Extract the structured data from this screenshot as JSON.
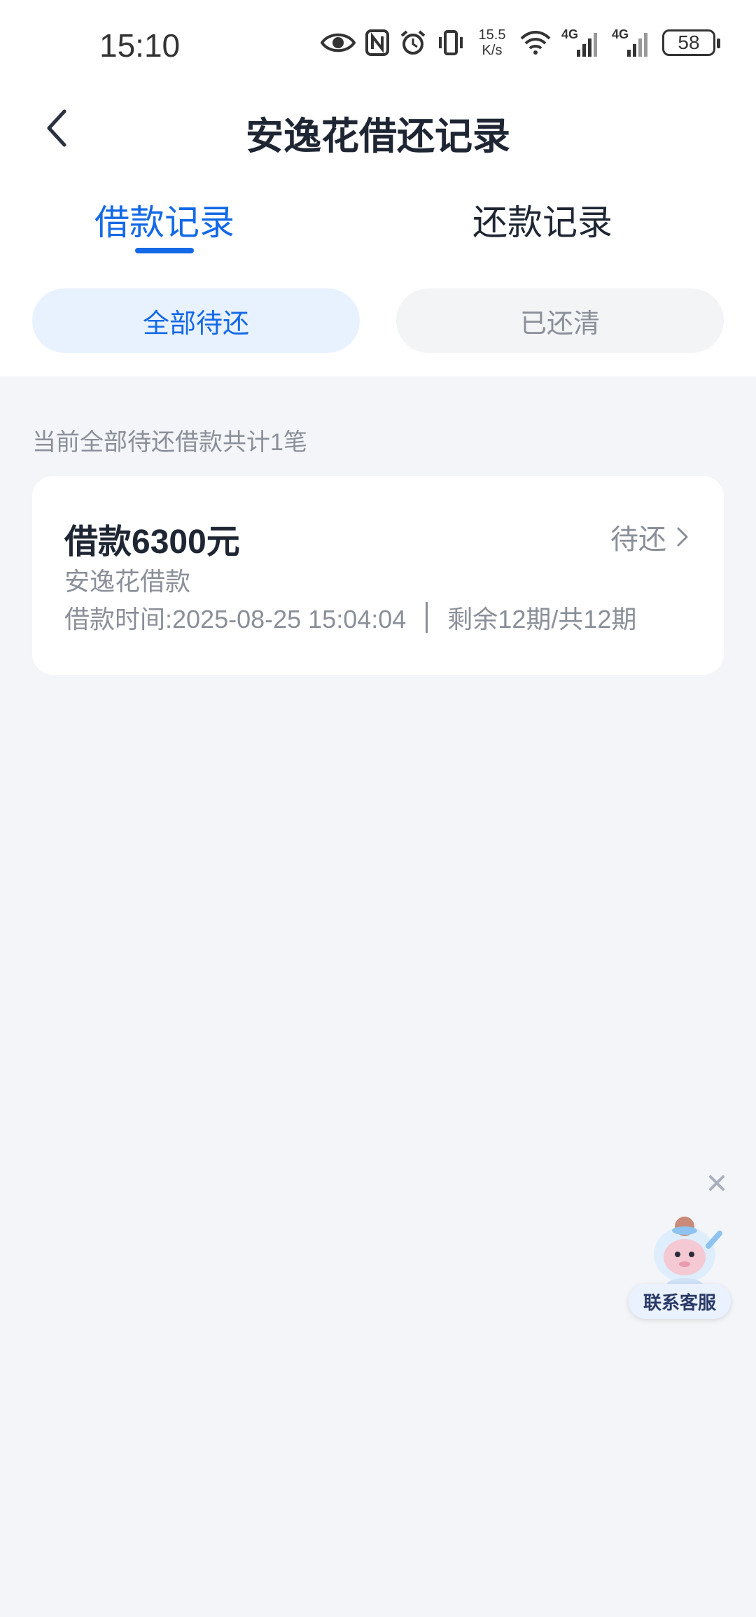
{
  "status_bar": {
    "time": "15:10",
    "net_speed_value": "15.5",
    "net_speed_unit": "K/s",
    "signal1_label": "4G",
    "signal2_label": "4G",
    "battery": "58",
    "icons": [
      "eye-icon",
      "nfc-icon",
      "alarm-icon",
      "vibrate-icon",
      "wifi-icon",
      "signal-icon",
      "signal-icon",
      "battery-icon"
    ]
  },
  "header": {
    "title": "安逸花借还记录",
    "back_icon": "chevron-left-icon"
  },
  "tabs": [
    {
      "label": "借款记录",
      "active": true
    },
    {
      "label": "还款记录",
      "active": false
    }
  ],
  "filters": [
    {
      "label": "全部待还",
      "active": true
    },
    {
      "label": "已还清",
      "active": false
    }
  ],
  "summary": "当前全部待还借款共计1笔",
  "loans": [
    {
      "amount_label": "借款6300元",
      "status": "待还",
      "product": "安逸花借款",
      "time_label": "借款时间:2025-08-25 15:04:04",
      "periods_label": "剩余12期/共12期"
    }
  ],
  "customer_service": {
    "label": "联系客服",
    "close_icon": "close-icon"
  },
  "colors": {
    "accent": "#1469e6",
    "text_primary": "#1f2633",
    "text_secondary": "#8a8f99",
    "background": "#f4f5f8",
    "pill_active_bg": "#e8f2ff"
  }
}
